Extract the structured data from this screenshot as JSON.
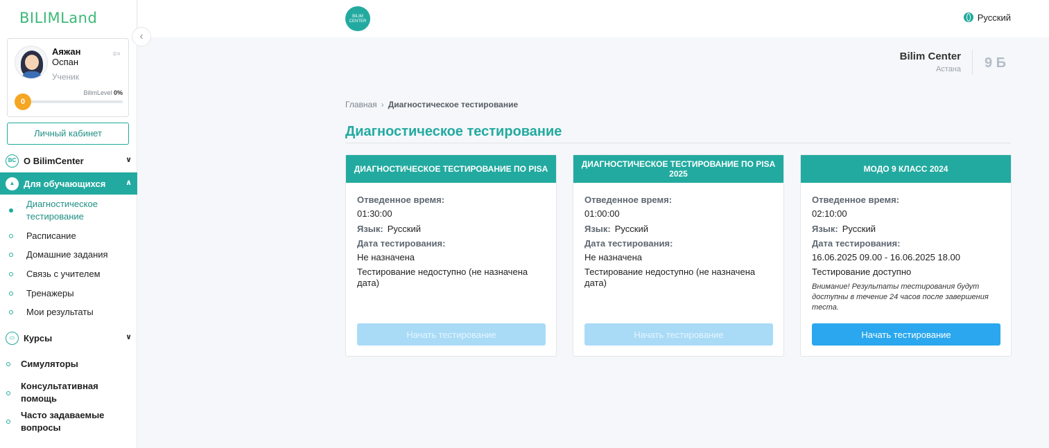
{
  "app": {
    "logo": "BILIMLand"
  },
  "profile": {
    "first_name": "Аяжан",
    "last_name": "Оспан",
    "role": "Ученик",
    "level_label": "BilimLevel",
    "level_percent": "0%",
    "level_value": "0"
  },
  "sidebar": {
    "cabinet_button": "Личный кабинет",
    "sections": [
      {
        "label": "О BilimCenter",
        "icon": "BC"
      },
      {
        "label": "Для обучающихся"
      },
      {
        "label": "Курсы"
      }
    ],
    "students_items": [
      "Диагностическое тестирование",
      "Расписание",
      "Домашние задания",
      "Связь с учителем",
      "Тренажеры",
      "Мои результаты"
    ],
    "extra_items": [
      "Симуляторы",
      "Консультативная помощь",
      "Часто задаваемые вопросы"
    ]
  },
  "header": {
    "center_logo": "BILIM CENTER",
    "language": "Русский"
  },
  "school": {
    "name": "Bilim Center",
    "city": "Астана",
    "grade": "9 Б"
  },
  "breadcrumb": {
    "home": "Главная",
    "current": "Диагностическое тестирование"
  },
  "page_title": "Диагностическое тестирование",
  "labels": {
    "time": "Отведенное время:",
    "language": "Язык:",
    "date": "Дата тестирования:",
    "start_button": "Начать тестирование"
  },
  "cards": [
    {
      "title": "ДИАГНОСТИЧЕСКОЕ ТЕСТИРОВАНИЕ ПО PISA",
      "time": "01:30:00",
      "language": "Русский",
      "date": "Не назначена",
      "status": "Тестирование недоступно (не назначена дата)",
      "note": "",
      "button_enabled": false
    },
    {
      "title": "ДИАГНОСТИЧЕСКОЕ ТЕСТИРОВАНИЕ ПО PISA 2025",
      "time": "01:00:00",
      "language": "Русский",
      "date": "Не назначена",
      "status": "Тестирование недоступно (не назначена дата)",
      "note": "",
      "button_enabled": false
    },
    {
      "title": "МОДО 9 КЛАСС 2024",
      "time": "02:10:00",
      "language": "Русский",
      "date": "16.06.2025 09.00 - 16.06.2025 18.00",
      "status": "Тестирование доступно",
      "note": "Внимание! Результаты тестирования будут доступны в течение 24 часов после завершения теста.",
      "button_enabled": true
    }
  ],
  "colors": {
    "accent": "#23aaa0",
    "button": "#2aa7ee",
    "button_disabled": "#a9dbf7",
    "level": "#f5a623"
  }
}
